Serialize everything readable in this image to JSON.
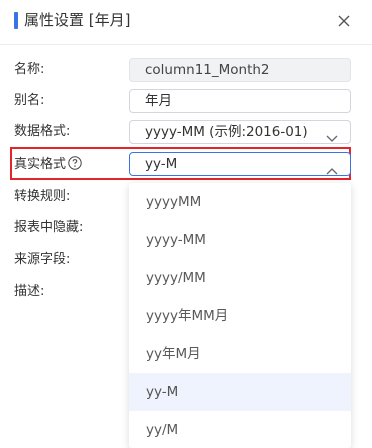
{
  "dialog": {
    "title": "属性设置 [年月]",
    "close_icon": "close-icon"
  },
  "form": {
    "name": {
      "label": "名称:",
      "value": "column11_Month2"
    },
    "alias": {
      "label": "别名:",
      "value": "年月"
    },
    "data_format": {
      "label": "数据格式:",
      "value": "yyyy-MM (示例:2016-01)"
    },
    "real_format": {
      "label": "真实格式",
      "value": "yy-M",
      "help_icon": "question-circle-icon"
    },
    "convert_rule": {
      "label": "转换规则:"
    },
    "hide_in_report": {
      "label": "报表中隐藏:"
    },
    "source_field": {
      "label": "来源字段:"
    },
    "description": {
      "label": "描述:"
    }
  },
  "dropdown": {
    "options": [
      "yyyyMM",
      "yyyy-MM",
      "yyyy/MM",
      "yyyy年MM月",
      "yy年M月",
      "yy-M",
      "yy/M"
    ],
    "selected": "yy-M"
  },
  "colors": {
    "accent": "#3b73e6",
    "highlight": "#e0252b",
    "selected_bg": "#eef3fd"
  }
}
